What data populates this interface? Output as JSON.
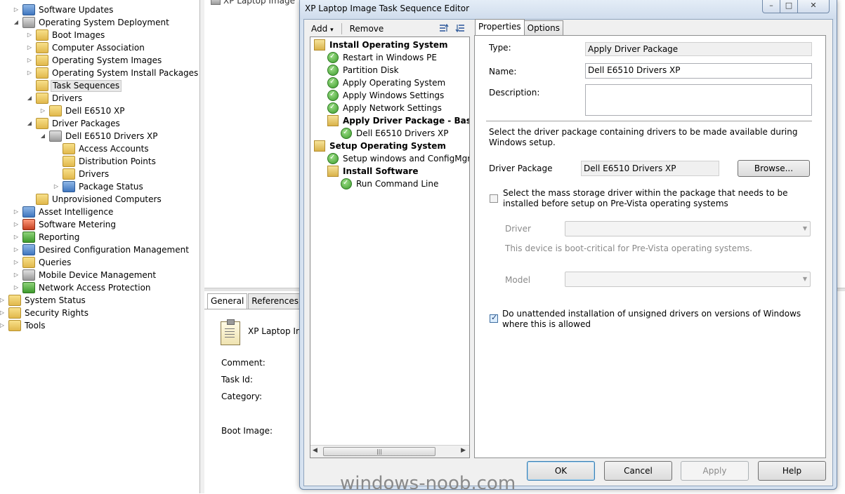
{
  "tree": {
    "items": [
      {
        "label": "Software Updates",
        "icon": "software-updates-icon"
      },
      {
        "label": "Operating System Deployment",
        "icon": "os-deployment-icon"
      },
      {
        "label": "Boot Images",
        "icon": "folder-icon"
      },
      {
        "label": "Computer Association",
        "icon": "folder-icon"
      },
      {
        "label": "Operating System Images",
        "icon": "folder-icon"
      },
      {
        "label": "Operating System Install Packages",
        "icon": "folder-icon"
      },
      {
        "label": "Task Sequences",
        "icon": "folder-icon"
      },
      {
        "label": "Drivers",
        "icon": "folder-icon"
      },
      {
        "label": "Dell E6510 XP",
        "icon": "driver-folder-icon"
      },
      {
        "label": "Driver Packages",
        "icon": "folder-icon"
      },
      {
        "label": "Dell E6510 Drivers XP",
        "icon": "package-icon"
      },
      {
        "label": "Access Accounts",
        "icon": "folder-icon"
      },
      {
        "label": "Distribution Points",
        "icon": "folder-icon"
      },
      {
        "label": "Drivers",
        "icon": "folder-icon"
      },
      {
        "label": "Package Status",
        "icon": "status-icon"
      },
      {
        "label": "Unprovisioned Computers",
        "icon": "folder-icon"
      },
      {
        "label": "Asset Intelligence",
        "icon": "asset-intelligence-icon"
      },
      {
        "label": "Software Metering",
        "icon": "metering-icon"
      },
      {
        "label": "Reporting",
        "icon": "reporting-icon"
      },
      {
        "label": "Desired Configuration Management",
        "icon": "dcm-icon"
      },
      {
        "label": "Queries",
        "icon": "queries-icon"
      },
      {
        "label": "Mobile Device Management",
        "icon": "mobile-icon"
      },
      {
        "label": "Network Access Protection",
        "icon": "nap-icon"
      },
      {
        "label": "System Status",
        "icon": "folder-icon"
      },
      {
        "label": "Security Rights",
        "icon": "folder-icon"
      },
      {
        "label": "Tools",
        "icon": "folder-icon"
      }
    ],
    "selected": "Task Sequences"
  },
  "background": {
    "top_item": "XP Laptop Image",
    "tabs": [
      "General",
      "References"
    ],
    "active_tab": "General",
    "name": "XP Laptop Ima",
    "fields": [
      "Comment:",
      "Task Id:",
      "Category:",
      "Boot Image:"
    ]
  },
  "watermark": "windows-noob.com",
  "dialog": {
    "title": "XP Laptop Image Task Sequence Editor",
    "window_buttons": {
      "minimize": "–",
      "maximize": "□",
      "close": "✕"
    },
    "toolbar": {
      "add": "Add",
      "add_arrow": "▾",
      "remove": "Remove"
    },
    "tasks": [
      {
        "label": "Install Operating System",
        "type": "group",
        "bold": true
      },
      {
        "label": "Restart in Windows PE",
        "type": "step",
        "bold": false
      },
      {
        "label": "Partition Disk",
        "type": "step",
        "bold": false
      },
      {
        "label": "Apply Operating System",
        "type": "step",
        "bold": false
      },
      {
        "label": "Apply Windows Settings",
        "type": "step",
        "bold": false
      },
      {
        "label": "Apply Network Settings",
        "type": "step",
        "bold": false
      },
      {
        "label": "Apply Driver Package - Based on",
        "type": "group",
        "bold": true
      },
      {
        "label": "Dell E6510 Drivers XP",
        "type": "step",
        "bold": false
      },
      {
        "label": "Setup Operating System",
        "type": "group",
        "bold": true
      },
      {
        "label": "Setup windows and ConfigMgr",
        "type": "step",
        "bold": false
      },
      {
        "label": "Install Software",
        "type": "group",
        "bold": true
      },
      {
        "label": "Run Command Line",
        "type": "step",
        "bold": false
      }
    ],
    "scroll_thumb_grip": "|||",
    "tabs": {
      "properties": "Properties",
      "options": "Options",
      "active": "Properties"
    },
    "properties": {
      "type_label": "Type:",
      "type_value": "Apply Driver Package",
      "name_label": "Name:",
      "name_value": "Dell E6510 Drivers XP",
      "description_label": "Description:",
      "description_value": "",
      "instruction": "Select the driver package containing drivers to be made available during Windows setup.",
      "driver_package_label": "Driver Package",
      "driver_package_value": "Dell E6510 Drivers XP",
      "browse": "Browse...",
      "mass_storage_label": "Select the mass storage driver within the package that needs to be installed before setup on Pre-Vista operating systems",
      "mass_storage_checked": false,
      "driver_label": "Driver",
      "driver_value": "",
      "boot_critical": "This device is boot-critical for Pre-Vista operating systems.",
      "model_label": "Model",
      "model_value": "",
      "unattended_label": "Do unattended installation of unsigned drivers on versions of Windows where this is allowed",
      "unattended_checked": true
    },
    "buttons": {
      "ok": "OK",
      "cancel": "Cancel",
      "apply": "Apply",
      "help": "Help"
    }
  }
}
